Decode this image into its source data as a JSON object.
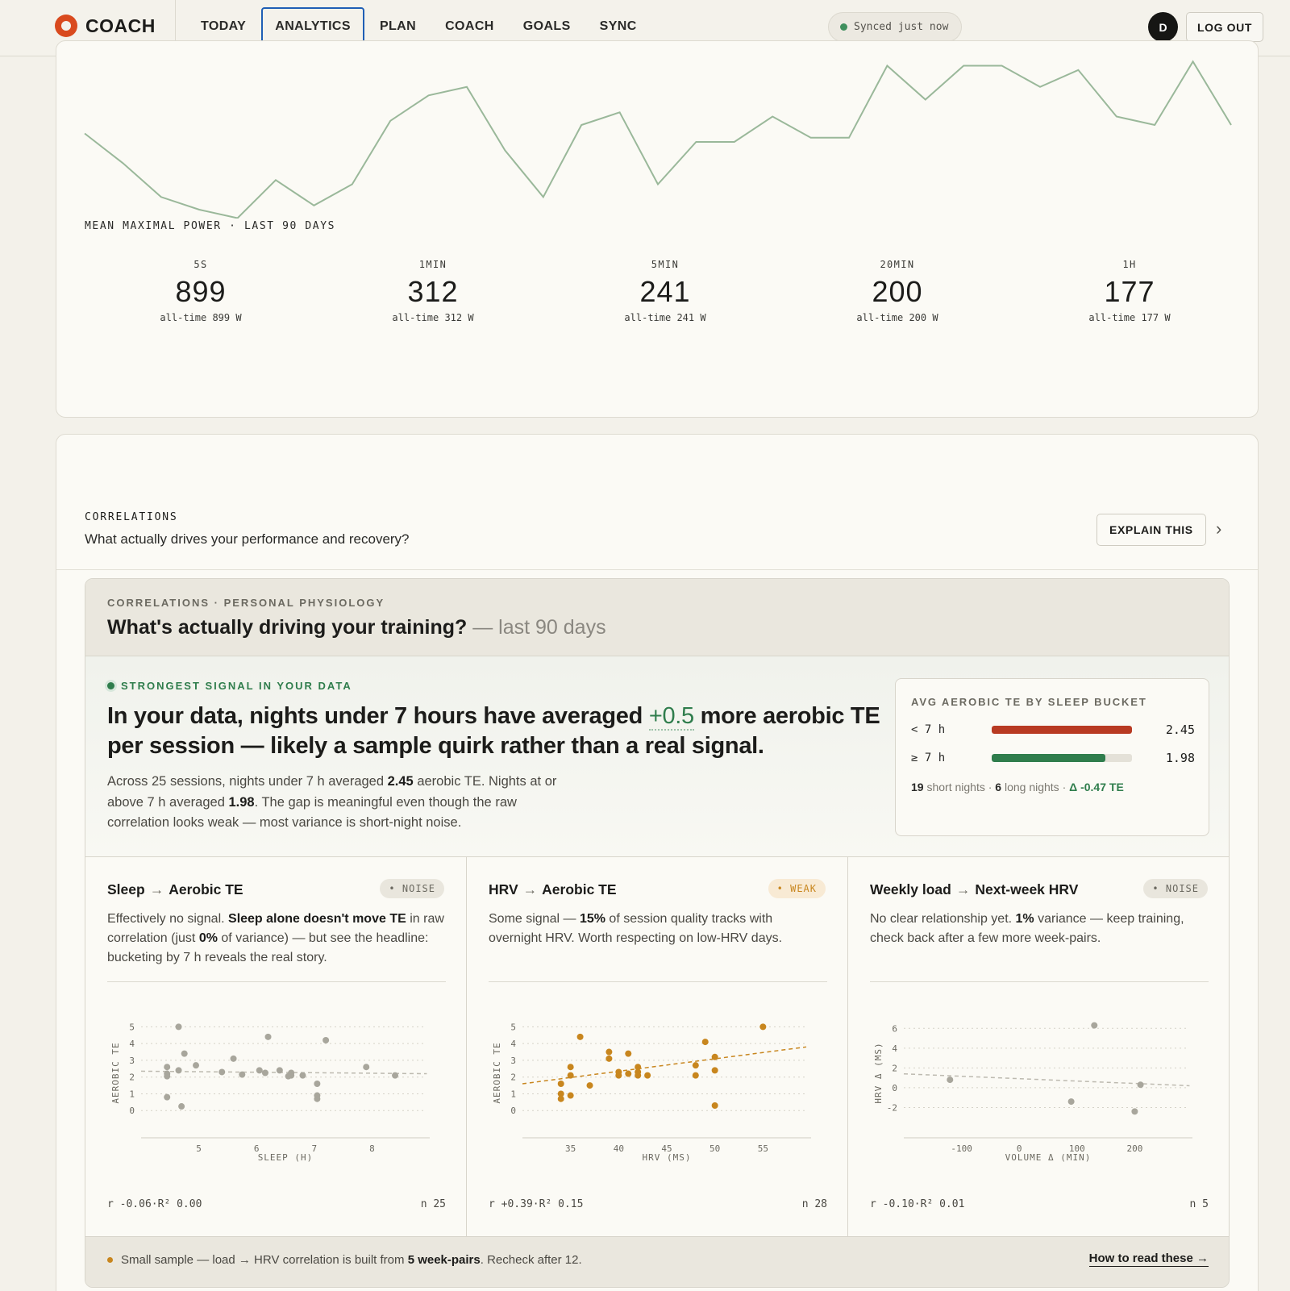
{
  "nav": {
    "brand": "COACH",
    "items": [
      {
        "label": "TODAY",
        "active": false
      },
      {
        "label": "ANALYTICS",
        "active": true
      },
      {
        "label": "PLAN",
        "active": false
      },
      {
        "label": "COACH",
        "active": false
      },
      {
        "label": "GOALS",
        "active": false
      },
      {
        "label": "SYNC",
        "active": false
      }
    ],
    "sync_status": "Synced just now",
    "avatar_initial": "D",
    "logout_label": "LOG OUT"
  },
  "mmp": {
    "label": "MEAN MAXIMAL POWER · LAST 90 DAYS",
    "series": [
      42,
      35,
      27,
      24,
      22,
      31,
      25,
      30,
      45,
      51,
      53,
      38,
      27,
      44,
      47,
      30,
      40,
      40,
      46,
      41,
      41,
      58,
      50,
      58,
      58,
      53,
      57,
      46,
      44,
      59,
      44
    ],
    "stats": [
      {
        "duration": "5S",
        "value": "899",
        "alltime": "all-time 899 W"
      },
      {
        "duration": "1MIN",
        "value": "312",
        "alltime": "all-time 312 W"
      },
      {
        "duration": "5MIN",
        "value": "241",
        "alltime": "all-time 241 W"
      },
      {
        "duration": "20MIN",
        "value": "200",
        "alltime": "all-time 200 W"
      },
      {
        "duration": "1H",
        "value": "177",
        "alltime": "all-time 177 W"
      }
    ]
  },
  "correlations": {
    "label": "CORRELATIONS",
    "question": "What actually drives your performance and recovery?",
    "explain_label": "EXPLAIN THIS",
    "kicker": "CORRELATIONS · PERSONAL PHYSIOLOGY",
    "title": "What's actually driving your training?",
    "title_sub": "— last 90 days",
    "signal": {
      "kicker": "STRONGEST SIGNAL IN YOUR DATA",
      "headline_pre": "In your data, nights under 7 hours have averaged ",
      "headline_delta": "+0.5",
      "headline_post": " more aerobic TE per session — likely a sample quirk rather than a real signal.",
      "body_1": "Across 25 sessions, nights under 7 h averaged ",
      "body_v1": "2.45",
      "body_2": " aerobic TE. Nights at or above 7 h averaged ",
      "body_v2": "1.98",
      "body_3": ". The gap is meaningful even though the raw correlation looks weak — most variance is short-night noise."
    },
    "bucket": {
      "title": "AVG AEROBIC TE BY SLEEP BUCKET",
      "rows": [
        {
          "label": "< 7 h",
          "value": "2.45",
          "fill": 1.0,
          "color": "#b83a22"
        },
        {
          "label": "≥ 7 h",
          "value": "1.98",
          "fill": 0.81,
          "color": "#2f7d4c"
        }
      ],
      "short_n": "19",
      "short_label": " short nights · ",
      "long_n": "6",
      "long_label": " long nights · ",
      "delta": "Δ -0.47 TE"
    },
    "panels": [
      {
        "x_name": "Sleep",
        "arrow": "→",
        "y_name": "Aerobic TE",
        "badge": "• NOISE",
        "badge_type": "noise",
        "body_1": "Effectively no signal. ",
        "body_b1": "Sleep alone doesn't move TE",
        "body_2": " in raw correlation (just ",
        "body_b2": "0%",
        "body_3": " of variance) — but see the headline: bucketing by 7 h reveals the real story.",
        "r": "r -0.06",
        "r2": "R² 0.00",
        "n": "n 25",
        "xlabel": "SLEEP (H)",
        "ylabel": "AEROBIC TE"
      },
      {
        "x_name": "HRV",
        "arrow": "→",
        "y_name": "Aerobic TE",
        "badge": "• WEAK",
        "badge_type": "weak",
        "body_1": "Some signal — ",
        "body_b1": "15%",
        "body_2": " of session quality tracks with overnight HRV. Worth respecting on low-HRV days.",
        "body_b2": "",
        "body_3": "",
        "r": "r +0.39",
        "r2": "R² 0.15",
        "n": "n 28",
        "xlabel": "HRV (MS)",
        "ylabel": "AEROBIC TE"
      },
      {
        "x_name": "Weekly load",
        "arrow": "→",
        "y_name": "Next-week HRV",
        "badge": "• NOISE",
        "badge_type": "noise",
        "body_1": "No clear relationship yet. ",
        "body_b1": "1%",
        "body_2": " variance — keep training, check back after a few more week-pairs.",
        "body_b2": "",
        "body_3": "",
        "r": "r -0.10",
        "r2": "R² 0.01",
        "n": "n 5",
        "xlabel": "VOLUME Δ (MIN)",
        "ylabel": "HRV Δ (MS)"
      }
    ],
    "footer": {
      "pre": "Small sample — load → HRV correlation is built from ",
      "bold": "5 week-pairs",
      "post": ". Recheck after 12.",
      "link": "How to read these →"
    }
  },
  "chart_data": [
    {
      "type": "scatter",
      "title": "Sleep → Aerobic TE",
      "xlabel": "SLEEP (H)",
      "ylabel": "AEROBIC TE",
      "xlim": [
        4,
        9
      ],
      "ylim": [
        -1,
        5.5
      ],
      "xticks": [
        5,
        6,
        7,
        8
      ],
      "yticks": [
        0,
        1,
        2,
        3,
        4,
        5
      ],
      "color": "#a8a69c",
      "trend": [
        [
          4,
          2.35
        ],
        [
          8.95,
          2.2
        ]
      ],
      "x": [
        4.45,
        4.45,
        4.45,
        4.45,
        4.65,
        4.65,
        4.7,
        4.75,
        4.95,
        5.4,
        5.6,
        5.75,
        6.05,
        6.15,
        6.2,
        6.4,
        6.55,
        6.6,
        6.6,
        6.8,
        7.05,
        7.05,
        7.05,
        7.2,
        7.9,
        8.4
      ],
      "y": [
        2.2,
        2.05,
        2.6,
        0.8,
        5,
        2.4,
        0.25,
        3.4,
        2.7,
        2.3,
        3.1,
        2.15,
        2.4,
        2.25,
        4.4,
        2.4,
        2.05,
        2.25,
        2.1,
        2.1,
        1.6,
        0.9,
        0.7,
        4.2,
        2.6,
        2.1
      ]
    },
    {
      "type": "scatter",
      "title": "HRV → Aerobic TE",
      "xlabel": "HRV (MS)",
      "ylabel": "AEROBIC TE",
      "xlim": [
        30,
        60
      ],
      "ylim": [
        -1,
        5.5
      ],
      "xticks": [
        35,
        40,
        45,
        50,
        55
      ],
      "yticks": [
        0,
        1,
        2,
        3,
        4,
        5
      ],
      "color": "#c8861e",
      "trend": [
        [
          30,
          1.6
        ],
        [
          59.5,
          3.8
        ]
      ],
      "x": [
        34,
        34,
        34,
        35,
        35,
        35,
        36,
        37,
        39,
        39,
        40,
        40,
        41,
        41,
        42,
        42,
        42,
        43,
        48,
        48,
        49,
        50,
        50,
        50,
        55
      ],
      "y": [
        1.6,
        1.0,
        0.7,
        2.6,
        2.1,
        0.9,
        4.4,
        1.5,
        3.5,
        3.1,
        2.1,
        2.3,
        2.2,
        3.4,
        2.6,
        2.3,
        2.1,
        2.1,
        2.7,
        2.1,
        4.1,
        3.2,
        2.4,
        0.3,
        5
      ]
    },
    {
      "type": "scatter",
      "title": "Weekly load → Next-week HRV",
      "xlabel": "VOLUME Δ (MIN)",
      "ylabel": "HRV Δ (MS)",
      "xlim": [
        -200,
        300
      ],
      "ylim": [
        -4,
        7
      ],
      "xticks": [
        -100,
        0,
        100,
        200
      ],
      "yticks": [
        -2,
        0,
        2,
        4,
        6
      ],
      "color": "#a8a69c",
      "trend": [
        [
          -200,
          1.4
        ],
        [
          295,
          0.2
        ]
      ],
      "x": [
        -120,
        90,
        130,
        210,
        200
      ],
      "y": [
        0.8,
        -1.4,
        6.3,
        0.3,
        -2.4
      ]
    }
  ]
}
